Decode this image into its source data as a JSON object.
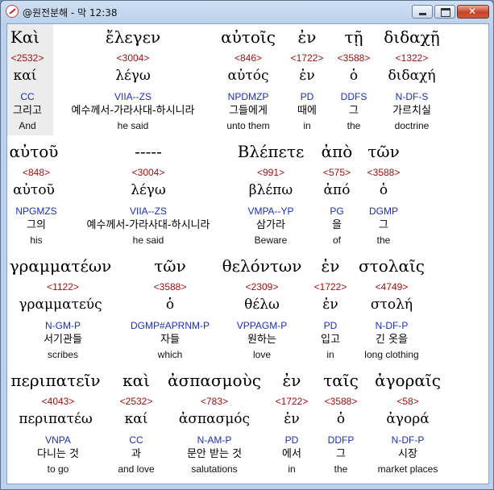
{
  "window": {
    "title": "@원전분해 - 막 12:38"
  },
  "rows": [
    {
      "words": [
        {
          "greek": "Καὶ",
          "strongs": "<2532>",
          "lemma": "καί",
          "morph": "CC",
          "korean": "그리고",
          "english": "And"
        },
        {
          "greek": "ἔλεγεν",
          "strongs": "<3004>",
          "lemma": "λέγω",
          "morph": "VIIA--ZS",
          "korean": "예수께서-가라사대-하시니라",
          "english": "he said"
        },
        {
          "greek": "αὐτοῖς",
          "strongs": "<846>",
          "lemma": "αὐτός",
          "morph": "NPDMZP",
          "korean": "그들에게",
          "english": "unto them"
        },
        {
          "greek": "ἐν",
          "strongs": "<1722>",
          "lemma": "ἐν",
          "morph": "PD",
          "korean": "때에",
          "english": "in"
        },
        {
          "greek": "τῇ",
          "strongs": "<3588>",
          "lemma": "ὁ",
          "morph": "DDFS",
          "korean": "그",
          "english": "the"
        },
        {
          "greek": "διδαχῇ",
          "strongs": "<1322>",
          "lemma": "διδαχή",
          "morph": "N-DF-S",
          "korean": "가르치실",
          "english": "doctrine"
        }
      ]
    },
    {
      "words": [
        {
          "greek": "αὐτοῦ",
          "strongs": "<848>",
          "lemma": "αὐτοῦ",
          "morph": "NPGMZS",
          "korean": "그의",
          "english": "his"
        },
        {
          "greek": "-----",
          "strongs": "<3004>",
          "lemma": "λέγω",
          "morph": "VIIA--ZS",
          "korean": "예수께서-가라사대-하시니라",
          "english": "he said"
        },
        {
          "greek": "Βλέπετε",
          "strongs": "<991>",
          "lemma": "βλέπω",
          "morph": "VMPA--YP",
          "korean": "삼가라",
          "english": "Beware"
        },
        {
          "greek": "ἀπὸ",
          "strongs": "<575>",
          "lemma": "ἀπό",
          "morph": "PG",
          "korean": "을",
          "english": "of"
        },
        {
          "greek": "τῶν",
          "strongs": "<3588>",
          "lemma": "ὁ",
          "morph": "DGMP",
          "korean": "그",
          "english": "the"
        }
      ]
    },
    {
      "words": [
        {
          "greek": "γραμματέων",
          "strongs": "<1122>",
          "lemma": "γραμματεύς",
          "morph": "N-GM-P",
          "korean": "서기관들",
          "english": "scribes"
        },
        {
          "greek": "τῶν",
          "strongs": "<3588>",
          "lemma": "ὁ",
          "morph": "DGMP#APRNM-P",
          "korean": "자들",
          "english": "which"
        },
        {
          "greek": "θελόντων",
          "strongs": "<2309>",
          "lemma": "θέλω",
          "morph": "VPPAGM-P",
          "korean": "원하는",
          "english": "love"
        },
        {
          "greek": "ἐν",
          "strongs": "<1722>",
          "lemma": "ἐν",
          "morph": "PD",
          "korean": "입고",
          "english": "in"
        },
        {
          "greek": "στολαῖς",
          "strongs": "<4749>",
          "lemma": "στολή",
          "morph": "N-DF-P",
          "korean": "긴 옷을",
          "english": "long clothing"
        }
      ]
    },
    {
      "words": [
        {
          "greek": "περιπατεῖν",
          "strongs": "<4043>",
          "lemma": "περιπατέω",
          "morph": "VNPA",
          "korean": "다니는 것",
          "english": "to go"
        },
        {
          "greek": "καὶ",
          "strongs": "<2532>",
          "lemma": "καί",
          "morph": "CC",
          "korean": "과",
          "english": "and love"
        },
        {
          "greek": "ἀσπασμοὺς",
          "strongs": "<783>",
          "lemma": "ἀσπασμός",
          "morph": "N-AM-P",
          "korean": "문안 받는 것",
          "english": "salutations"
        },
        {
          "greek": "ἐν",
          "strongs": "<1722>",
          "lemma": "ἐν",
          "morph": "PD",
          "korean": "에서",
          "english": "in"
        },
        {
          "greek": "ταῖς",
          "strongs": "<3588>",
          "lemma": "ὁ",
          "morph": "DDFP",
          "korean": "그",
          "english": "the"
        },
        {
          "greek": "ἀγοραῖς",
          "strongs": "<58>",
          "lemma": "ἀγορά",
          "morph": "N-DF-P",
          "korean": "시장",
          "english": "market places"
        }
      ]
    }
  ]
}
